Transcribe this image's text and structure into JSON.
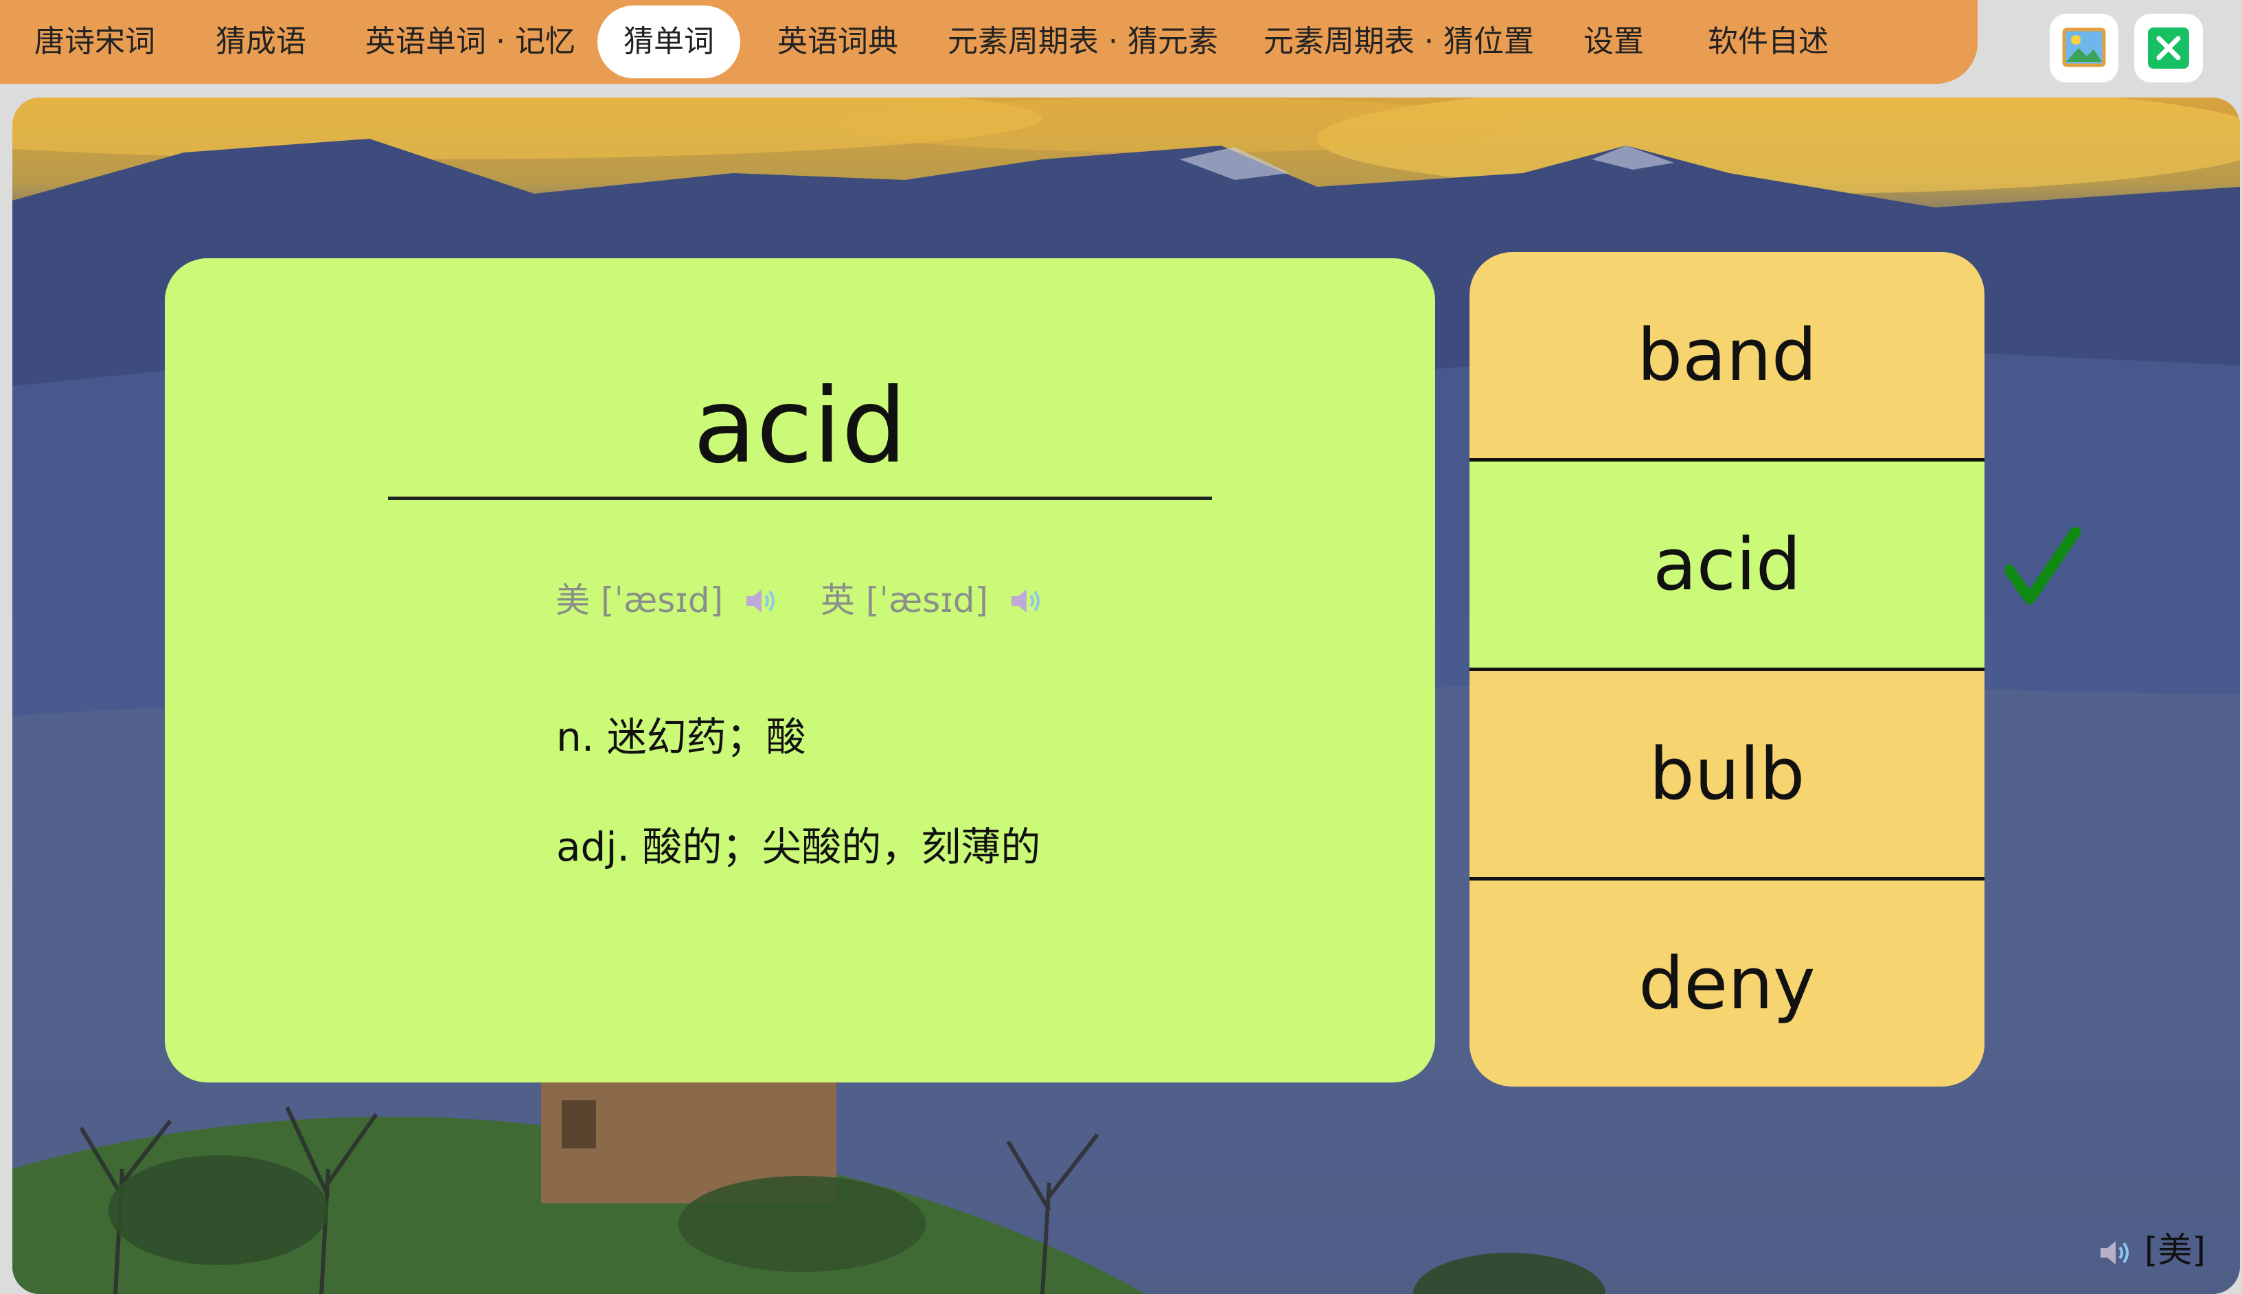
{
  "tabs": [
    {
      "label": "唐诗宋词",
      "active": false
    },
    {
      "label": "猜成语",
      "active": false
    },
    {
      "label": "英语单词 · 记忆",
      "active": false
    },
    {
      "label": "猜单词",
      "active": true
    },
    {
      "label": "英语词典",
      "active": false
    },
    {
      "label": "元素周期表 · 猜元素",
      "active": false
    },
    {
      "label": "元素周期表 · 猜位置",
      "active": false
    },
    {
      "label": "设置",
      "active": false
    },
    {
      "label": "软件自述",
      "active": false
    }
  ],
  "window_controls": {
    "wallpaper_icon": "picture-icon",
    "close_icon": "close-icon",
    "close_color": "#18c064"
  },
  "card": {
    "word": "acid",
    "us_label": "美",
    "us_phonetic": "[ˈæsɪd]",
    "uk_label": "英",
    "uk_phonetic": "[ˈæsɪd]",
    "definitions": [
      "n. 迷幻药；酸",
      "adj. 酸的；尖酸的，刻薄的"
    ],
    "background_color": "#cbfa78"
  },
  "options": [
    {
      "word": "band",
      "state": "neutral"
    },
    {
      "word": "acid",
      "state": "correct"
    },
    {
      "word": "bulb",
      "state": "neutral"
    },
    {
      "word": "deny",
      "state": "neutral"
    }
  ],
  "colors": {
    "tab_bar": "#e99d52",
    "option_neutral": "#f6d46f",
    "option_correct": "#cbfa78",
    "check_mark": "#0e8a12"
  },
  "accent_toggle": {
    "label": "[美]",
    "icon": "speaker-icon"
  }
}
